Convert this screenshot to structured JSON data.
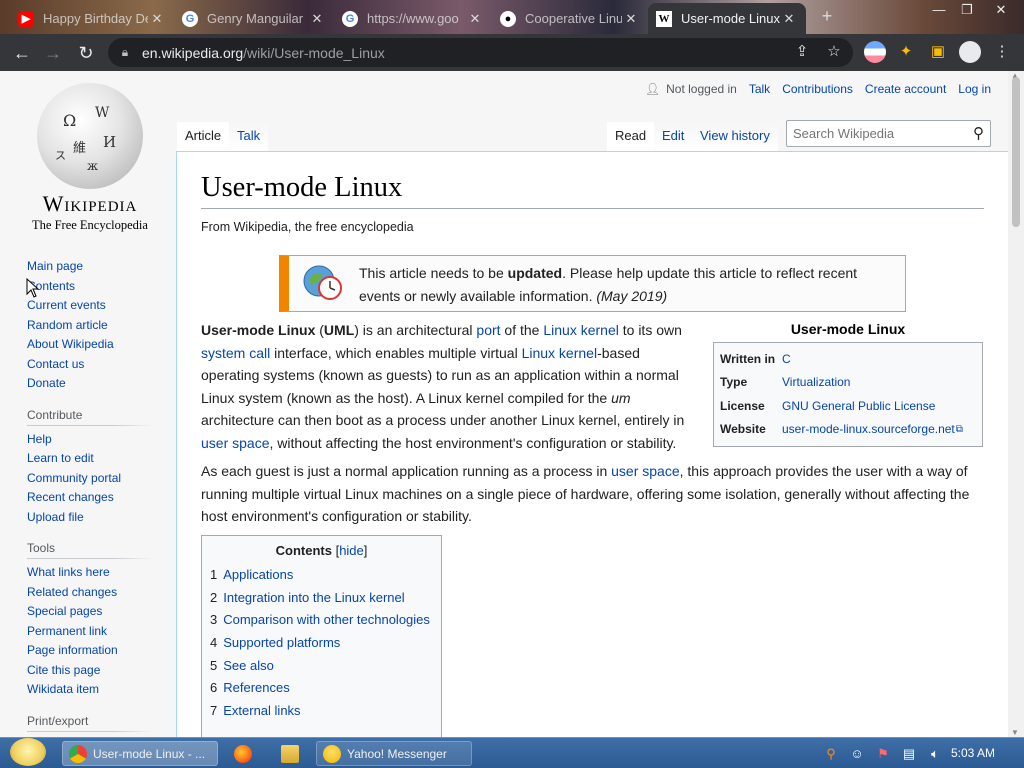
{
  "browser": {
    "tabs": [
      {
        "title": "Happy Birthday Dear",
        "favicon": "youtube-icon"
      },
      {
        "title": "Genry Manguilar",
        "favicon": "google-icon"
      },
      {
        "title": "https://www.goo",
        "favicon": "google-icon"
      },
      {
        "title": "Cooperative Linux",
        "favicon": "coop-linux-icon"
      },
      {
        "title": "User-mode Linux",
        "favicon": "wikipedia-icon",
        "active": true
      }
    ],
    "close_glyph": "✕",
    "new_tab_glyph": "+",
    "url_domain": "en.wikipedia.org",
    "url_path": "/wiki/User-mode_Linux"
  },
  "wiki": {
    "logo": {
      "wordmark": "Wikipedia",
      "tagline": "The Free Encyclopedia"
    },
    "personal": {
      "not_logged_in": "Not logged in",
      "talk": "Talk",
      "contributions": "Contributions",
      "create_account": "Create account",
      "log_in": "Log in"
    },
    "tabs": {
      "article": "Article",
      "talk": "Talk",
      "read": "Read",
      "edit": "Edit",
      "history": "View history"
    },
    "search_placeholder": "Search Wikipedia",
    "sidebar": {
      "main": [
        "Main page",
        "Contents",
        "Current events",
        "Random article",
        "About Wikipedia",
        "Contact us",
        "Donate"
      ],
      "contribute_heading": "Contribute",
      "contribute": [
        "Help",
        "Learn to edit",
        "Community portal",
        "Recent changes",
        "Upload file"
      ],
      "tools_heading": "Tools",
      "tools": [
        "What links here",
        "Related changes",
        "Special pages",
        "Permanent link",
        "Page information",
        "Cite this page",
        "Wikidata item"
      ],
      "print_heading": "Print/export"
    },
    "title": "User-mode Linux",
    "sitesub": "From Wikipedia, the free encyclopedia",
    "ambox": {
      "pre": "This article needs to be ",
      "bold": "updated",
      "post": ". Please help update this article to reflect recent events or newly available information.",
      "date": "(May 2019)"
    },
    "intro": {
      "b1": "User-mode Linux",
      "t1": " (",
      "b2": "UML",
      "t2": ") is an architectural ",
      "l1": "port",
      "t3": " of the ",
      "l2": "Linux kernel",
      "t4": " to its own ",
      "l3": "system call",
      "t5": " interface, which enables multiple virtual ",
      "l4": "Linux kernel",
      "t6": "-based operating systems (known as guests) to run as an application within a normal Linux system (known as the host). A Linux kernel compiled for the ",
      "i1": "um",
      "t7": " architecture can then boot as a process under another Linux kernel, entirely in ",
      "l5": "user space",
      "t8": ", without affecting the host environment's configuration or stability."
    },
    "para2": {
      "t1": "As each guest is just a normal application running as a process in ",
      "l1": "user space",
      "t2": ", this approach provides the user with a way of running multiple virtual Linux machines on a single piece of hardware, offering some isolation, generally without affecting the host environment's configuration or stability."
    },
    "infobox": {
      "title": "User-mode Linux",
      "rows": [
        {
          "key": "Written in",
          "value": "C"
        },
        {
          "key": "Type",
          "value": "Virtualization"
        },
        {
          "key": "License",
          "value": "GNU General Public License"
        },
        {
          "key": "Website",
          "value": "user-mode-linux.sourceforge.net"
        }
      ]
    },
    "toc": {
      "title": "Contents",
      "hide": "hide",
      "items": [
        {
          "num": "1",
          "label": "Applications"
        },
        {
          "num": "2",
          "label": "Integration into the Linux kernel"
        },
        {
          "num": "3",
          "label": "Comparison with other technologies"
        },
        {
          "num": "4",
          "label": "Supported platforms"
        },
        {
          "num": "5",
          "label": "See also"
        },
        {
          "num": "6",
          "label": "References"
        },
        {
          "num": "7",
          "label": "External links"
        }
      ]
    }
  },
  "taskbar": {
    "chrome_window": "User-mode Linux - ...",
    "messenger_window": "Yahoo! Messenger",
    "clock": "5:03 AM"
  }
}
